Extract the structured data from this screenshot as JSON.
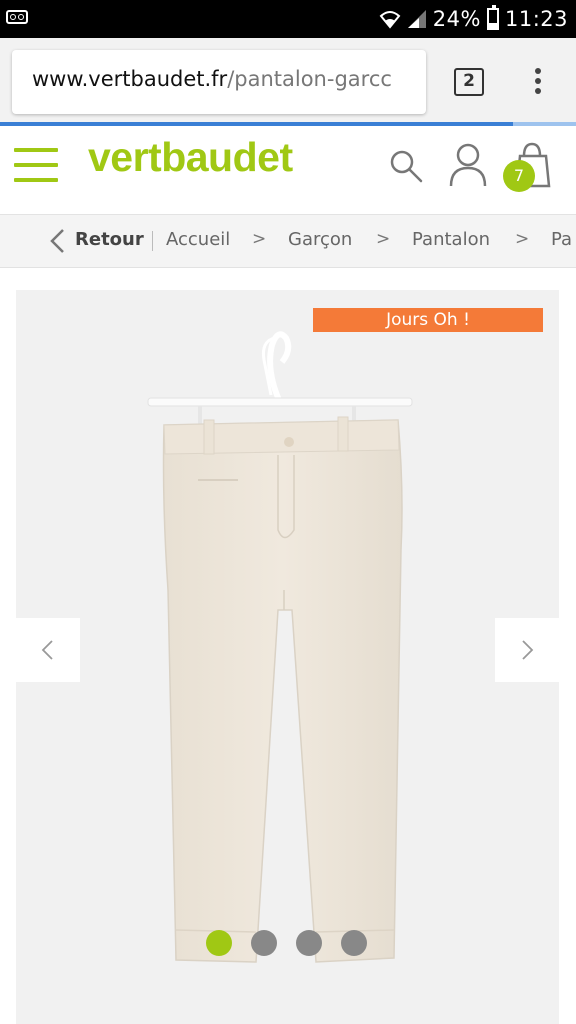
{
  "status_bar": {
    "battery_percent": "24%",
    "time": "11:23",
    "icons": [
      "voicemail-icon",
      "wifi-icon",
      "signal-icon",
      "battery-icon"
    ]
  },
  "browser": {
    "url_host": "www.vertbaudet.fr",
    "url_path": "/pantalon-garcc",
    "tab_count": "2",
    "icons": [
      "tabs-icon",
      "more-vert-icon"
    ],
    "progress": 0.89
  },
  "header": {
    "logo": "vertbaudet",
    "cart_count": "7",
    "icons": [
      "menu-icon",
      "search-icon",
      "user-icon",
      "bag-icon"
    ],
    "accent_color": "#a0c814"
  },
  "breadcrumb": {
    "back_label": "Retour",
    "items": [
      "Accueil",
      "Garçon",
      "Pantalon",
      "Pa"
    ],
    "separator": ">"
  },
  "product": {
    "promo_badge": "Jours Oh !",
    "promo_color": "#f47a38",
    "image_count": 4,
    "active_image": 1,
    "icons": [
      "chevron-left-icon",
      "chevron-right-icon"
    ]
  }
}
